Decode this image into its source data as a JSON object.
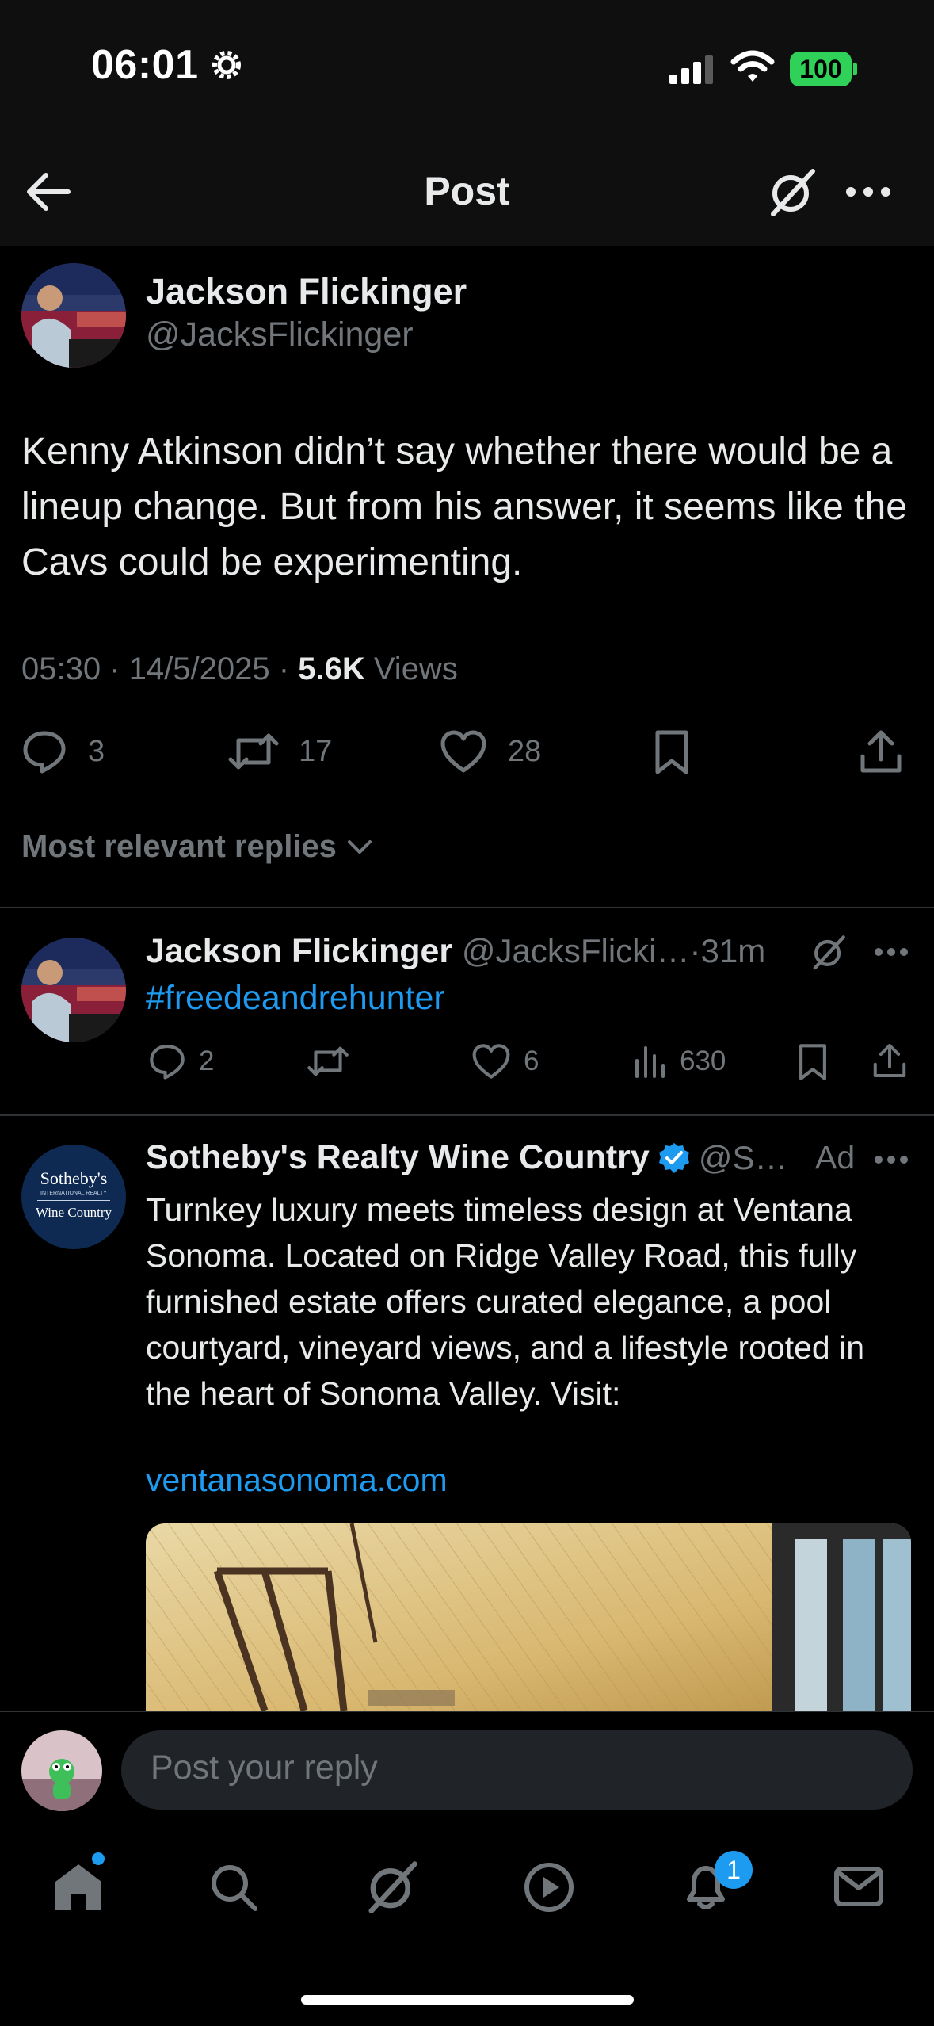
{
  "status_bar": {
    "time": "06:01",
    "battery": "100"
  },
  "nav": {
    "title": "Post"
  },
  "post": {
    "author_name": "Jackson Flickinger",
    "author_handle": "@JacksFlickinger",
    "text": "Kenny Atkinson didn’t say whether there would be a lineup change. But from his answer, it seems like the Cavs could be experimenting.",
    "time": "05:30",
    "date": "14/5/2025",
    "separator": "·",
    "views_count": "5.6K",
    "views_label": "Views",
    "replies": "3",
    "reposts": "17",
    "likes": "28"
  },
  "sort": {
    "label": "Most relevant replies"
  },
  "reply": {
    "author_name": "Jackson Flickinger",
    "author_handle": "@JacksFlicki…",
    "time": "·31m",
    "text": "#freedeandrehunter",
    "replies": "2",
    "likes": "6",
    "views": "630"
  },
  "ad": {
    "author_name": "Sotheby's Realty Wine Country",
    "author_handle": "@S…",
    "ad_label": "Ad",
    "logo_line1": "Sotheby's",
    "logo_line2": "INTERNATIONAL REALTY",
    "logo_line3": "Wine Country",
    "text": "Turnkey luxury meets timeless design at Ventana Sonoma. Located on Ridge Valley Road, this fully furnished estate offers curated elegance, a pool courtyard, vineyard views, and a lifestyle rooted in the heart of Sonoma Valley. Visit:",
    "link": "ventanasonoma.com"
  },
  "reply_bar": {
    "placeholder": "Post your reply"
  },
  "tab_bar": {
    "notifications_badge": "1"
  },
  "colors": {
    "accent": "#1d9bf0",
    "muted": "#71767b",
    "battery": "#30d158",
    "background": "#000000"
  }
}
